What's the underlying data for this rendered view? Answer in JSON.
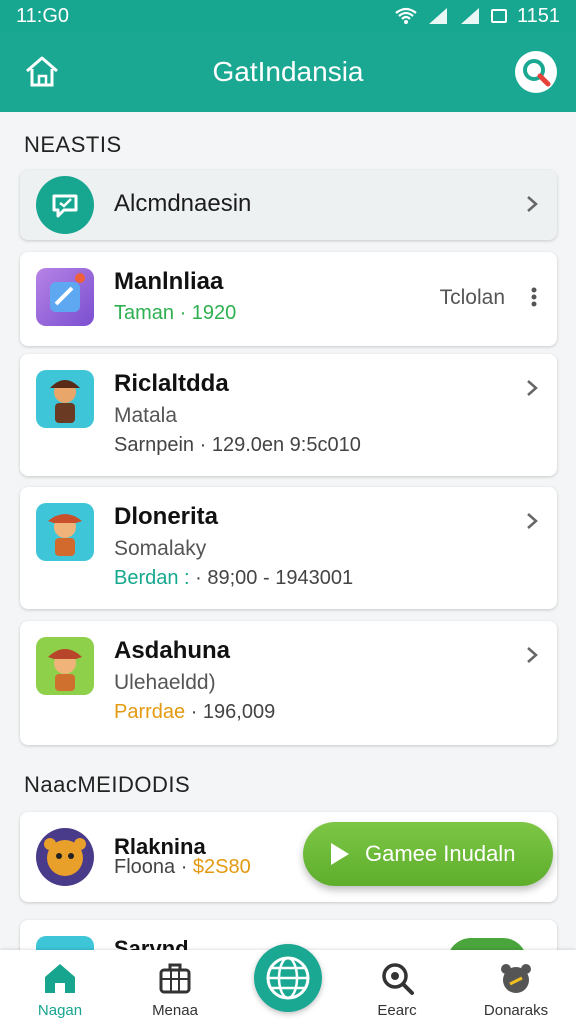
{
  "status": {
    "time": "11:G0",
    "right_time": "1151"
  },
  "appbar": {
    "title": "GatIndansia"
  },
  "section1": {
    "title": "NEASTIS"
  },
  "featured": {
    "label": "Alcmdnaesin"
  },
  "apps": [
    {
      "name": "Manlnliaa",
      "meta_prefix": "Taman",
      "meta_rest": " · 1920",
      "side_text": "Tclolan",
      "prefix_color": "green"
    },
    {
      "name": "Riclaltdda",
      "sub": "Matala",
      "meta": "Sarnpein · 129.0en 9:5c010"
    },
    {
      "name": "Dlonerita",
      "sub": "Somalaky",
      "meta_prefix": "Berdan :",
      "meta_rest": " · 89;00 - 1943001"
    },
    {
      "name": "Asdahuna",
      "sub": "Ulehaeldd)",
      "meta_prefix": "Parrdae",
      "meta_rest": " · 196,009"
    }
  ],
  "section2": {
    "title": "NaacMEIDODIS"
  },
  "promo": {
    "name": "Rlaknina",
    "meta_prefix": "Floona ·",
    "price": " $2S80",
    "cta": "Gamee Inudaln",
    "partial_name": "Sarvnd"
  },
  "nav": [
    {
      "label": "Nagan",
      "icon": "home-icon",
      "active": true
    },
    {
      "label": "Menaa",
      "icon": "briefcase-icon"
    },
    {
      "label": "",
      "icon": "globe-icon"
    },
    {
      "label": "Eearc",
      "icon": "search-icon"
    },
    {
      "label": "Donaraks",
      "icon": "bear-icon"
    }
  ],
  "colors": {
    "primary": "#1aa892",
    "cta": "#6bb838",
    "accent_orange": "#e39a10"
  }
}
